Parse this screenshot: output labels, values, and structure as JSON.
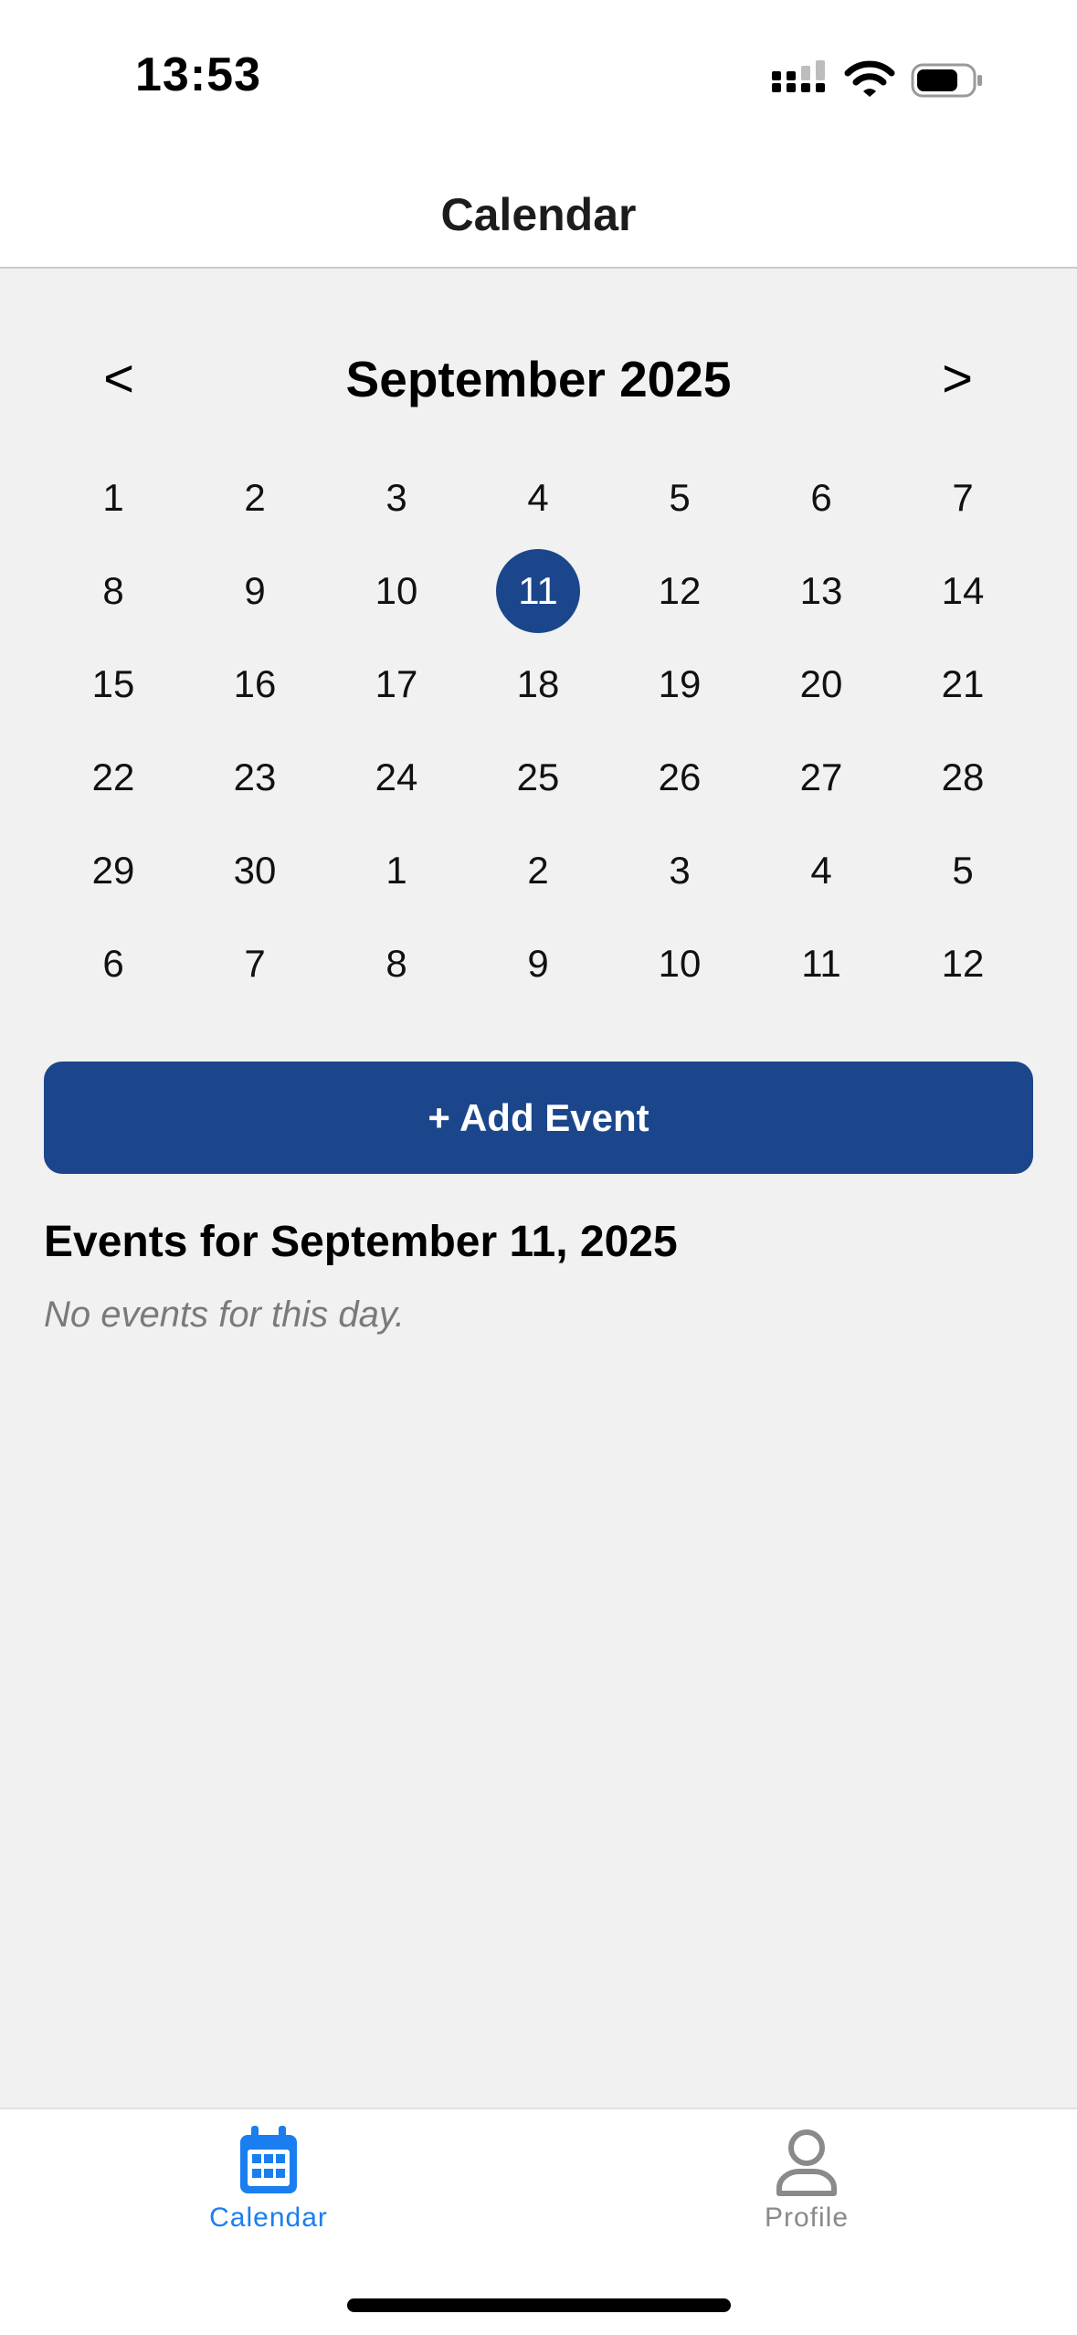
{
  "status_bar": {
    "time": "13:53",
    "icons": [
      "cellular-signal-icon",
      "wifi-icon",
      "battery-icon"
    ]
  },
  "header": {
    "title": "Calendar"
  },
  "calendar": {
    "month_label": "September 2025",
    "prev_label": "<",
    "next_label": ">",
    "selected_day": "11",
    "weeks": [
      [
        "1",
        "2",
        "3",
        "4",
        "5",
        "6",
        "7"
      ],
      [
        "8",
        "9",
        "10",
        "11",
        "12",
        "13",
        "14"
      ],
      [
        "15",
        "16",
        "17",
        "18",
        "19",
        "20",
        "21"
      ],
      [
        "22",
        "23",
        "24",
        "25",
        "26",
        "27",
        "28"
      ],
      [
        "29",
        "30",
        "1",
        "2",
        "3",
        "4",
        "5"
      ],
      [
        "6",
        "7",
        "8",
        "9",
        "10",
        "11",
        "12"
      ]
    ]
  },
  "actions": {
    "add_event_label": "+ Add Event"
  },
  "events": {
    "heading": "Events for September 11, 2025",
    "empty_text": "No events for this day."
  },
  "tab_bar": {
    "tabs": [
      {
        "label": "Calendar",
        "icon": "calendar-icon",
        "active": true
      },
      {
        "label": "Profile",
        "icon": "person-icon",
        "active": false
      }
    ]
  },
  "colors": {
    "accent": "#1b468c",
    "tab_active": "#1a7ef0",
    "tab_inactive": "#8a8a8a",
    "background": "#f1f1f1"
  }
}
